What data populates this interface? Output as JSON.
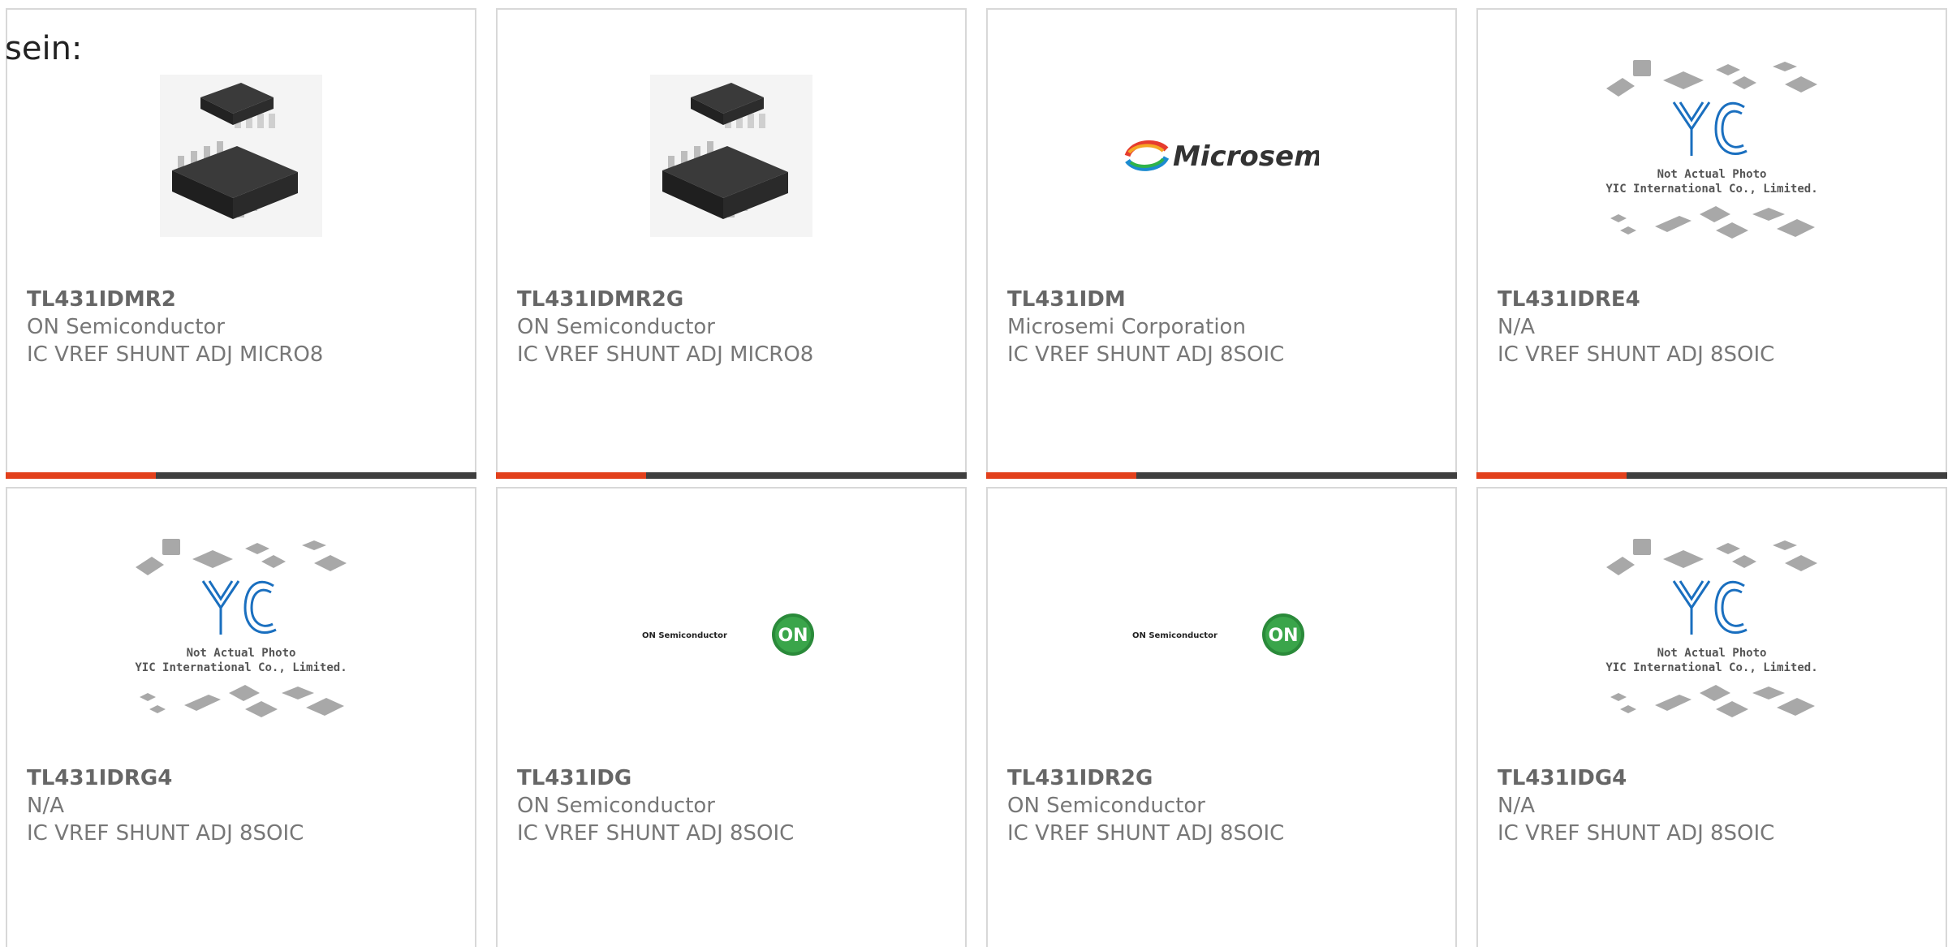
{
  "intro_text": "sein:",
  "colors": {
    "accent": "#e2401c",
    "bar": "#3f3f3f",
    "border": "#d8d8d8"
  },
  "logo_text": {
    "microsemi": "Microsemi",
    "on_semi": "ON Semiconductor",
    "on_badge": "ON",
    "yic_brand": "YIC",
    "yic_line1": "Not Actual Photo",
    "yic_line2": "YIC International Co., Limited."
  },
  "products": [
    {
      "part": "TL431IDMR2",
      "manufacturer": "ON Semiconductor",
      "description": "IC VREF SHUNT ADJ MICRO8",
      "image": "chip-package-photo"
    },
    {
      "part": "TL431IDMR2G",
      "manufacturer": "ON Semiconductor",
      "description": "IC VREF SHUNT ADJ MICRO8",
      "image": "chip-package-photo"
    },
    {
      "part": "TL431IDM",
      "manufacturer": "Microsemi Corporation",
      "description": "IC VREF SHUNT ADJ 8SOIC",
      "image": "microsemi-logo"
    },
    {
      "part": "TL431IDRE4",
      "manufacturer": "N/A",
      "description": "IC VREF SHUNT ADJ 8SOIC",
      "image": "yic-placeholder"
    },
    {
      "part": "TL431IDRG4",
      "manufacturer": "N/A",
      "description": "IC VREF SHUNT ADJ 8SOIC",
      "image": "yic-placeholder"
    },
    {
      "part": "TL431IDG",
      "manufacturer": "ON Semiconductor",
      "description": "IC VREF SHUNT ADJ 8SOIC",
      "image": "on-semi-logo"
    },
    {
      "part": "TL431IDR2G",
      "manufacturer": "ON Semiconductor",
      "description": "IC VREF SHUNT ADJ 8SOIC",
      "image": "on-semi-logo"
    },
    {
      "part": "TL431IDG4",
      "manufacturer": "N/A",
      "description": "IC VREF SHUNT ADJ 8SOIC",
      "image": "yic-placeholder"
    }
  ]
}
